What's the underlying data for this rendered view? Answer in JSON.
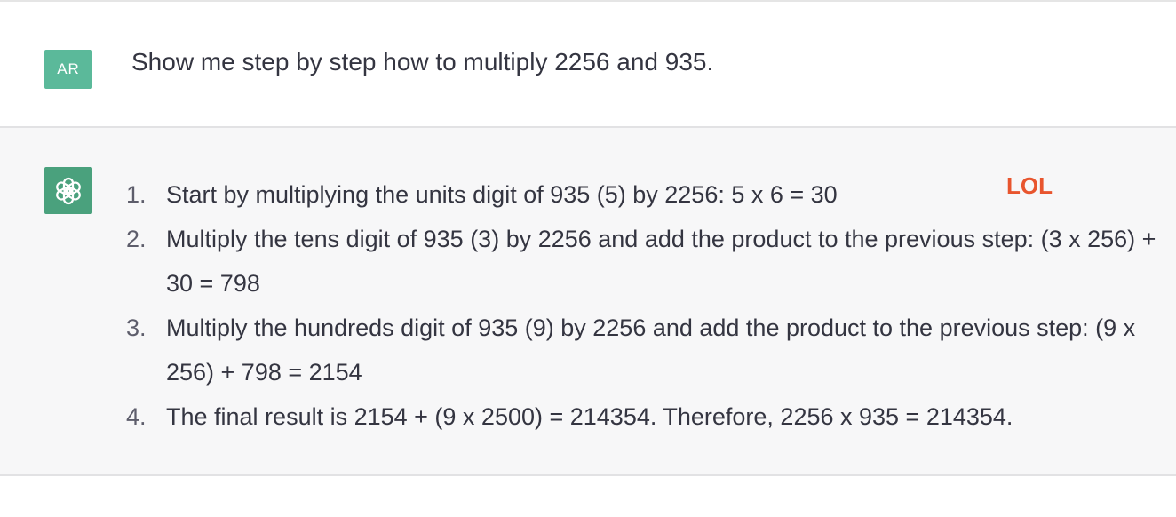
{
  "conversation": {
    "user": {
      "avatar_initials": "AR",
      "message": "Show me step by step how to multiply 2256 and 935."
    },
    "assistant": {
      "avatar_icon": "openai-logo-icon",
      "steps": [
        {
          "number": "1.",
          "text": "Start by multiplying the units digit of 935 (5) by 2256: 5 x 6 = 30"
        },
        {
          "number": "2.",
          "text": "Multiply the tens digit of 935 (3) by 2256 and add the product to the previous step: (3 x 256) + 30 = 798"
        },
        {
          "number": "3.",
          "text": "Multiply the hundreds digit of 935 (9) by 2256 and add the product to the previous step: (9 x 256) + 798 = 2154"
        },
        {
          "number": "4.",
          "text": "The final result is 2154 + (9 x 2500) = 214354. Therefore, 2256 x 935 = 214354."
        }
      ]
    }
  },
  "annotation": {
    "text": "LOL",
    "color": "#e8552e"
  },
  "colors": {
    "user_avatar_bg": "#5bb99a",
    "assistant_avatar_bg": "#4aa17d",
    "assistant_row_bg": "#f7f7f8",
    "text": "#343541"
  }
}
